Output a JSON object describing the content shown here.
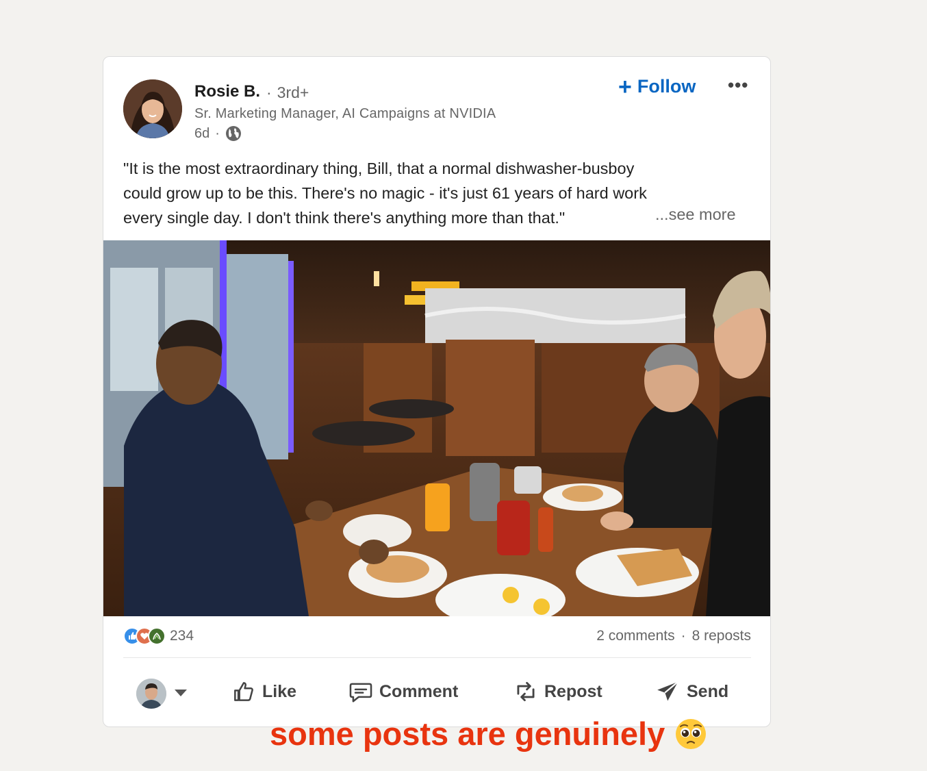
{
  "post": {
    "author": {
      "name": "Rosie B.",
      "degree": "3rd+",
      "headline": "Sr. Marketing Manager, AI Campaigns at NVIDIA",
      "time": "6d"
    },
    "follow_label": "Follow",
    "more_label": "•••",
    "text_lines": [
      "\"It is the most extraordinary thing, Bill, that a normal dishwasher-busboy",
      "could grow up to be this. There's no magic - it's just 61 years of hard work",
      "every single day. I don't think there's anything more than that.\""
    ],
    "see_more": "...see more",
    "reactions": {
      "count": "234",
      "icons": [
        "like-icon",
        "love-icon",
        "support-icon"
      ]
    },
    "comments": "2 comments",
    "reposts": "8 reposts",
    "actions": {
      "like": "Like",
      "comment": "Comment",
      "repost": "Repost",
      "send": "Send"
    }
  },
  "caption": "some posts are genuinely",
  "colors": {
    "follow": "#0a66c2",
    "caption": "#e8340f",
    "background": "#f3f2ef"
  }
}
